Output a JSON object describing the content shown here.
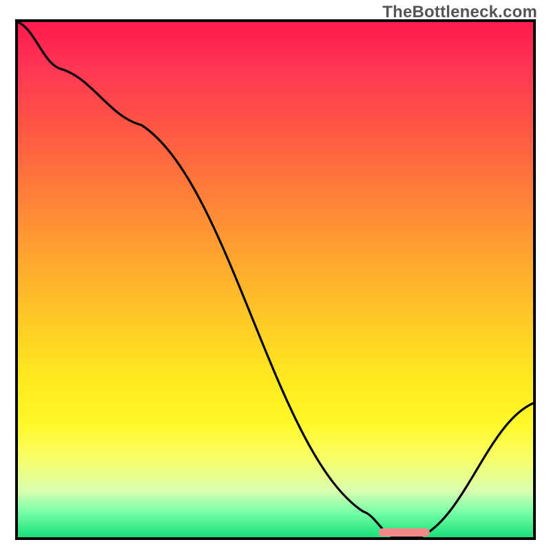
{
  "watermark": "TheBottleneck.com",
  "chart_data": {
    "type": "line",
    "title": "",
    "xlabel": "",
    "ylabel": "",
    "xlim": [
      0,
      100
    ],
    "ylim": [
      0,
      100
    ],
    "x": [
      0,
      8,
      24,
      67,
      73,
      78,
      100
    ],
    "values": [
      100,
      91,
      80,
      5,
      0,
      0,
      26
    ],
    "marker": {
      "x_start": 70,
      "x_end": 80,
      "y": 1
    },
    "background": "vertical-gradient red→yellow→green"
  }
}
